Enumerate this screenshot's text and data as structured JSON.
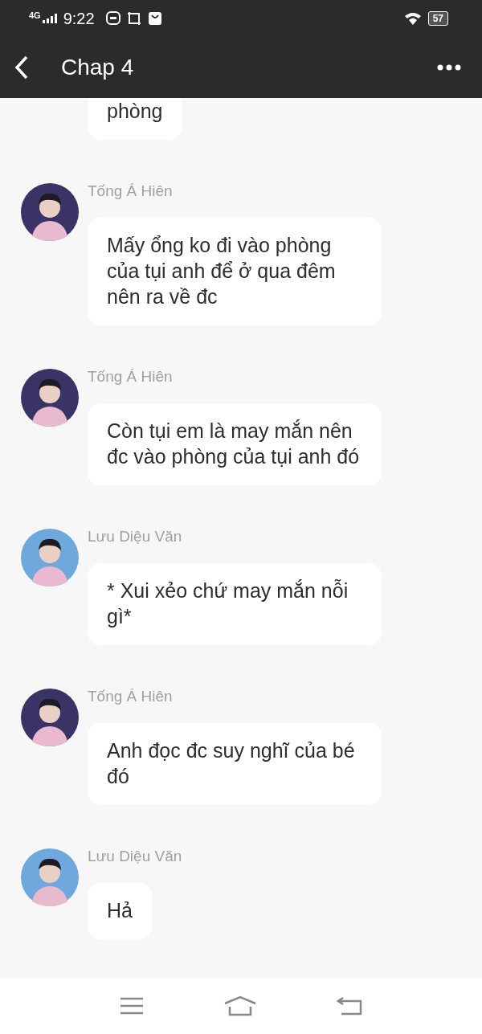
{
  "status_bar": {
    "network": "4G",
    "time": "9:22",
    "battery": "57"
  },
  "header": {
    "title": "Chap 4"
  },
  "messages": [
    {
      "text": "phòng"
    },
    {
      "sender": "Tống Á Hiên",
      "color": "#3a3466",
      "text": "Mấy ổng ko đi vào phòng của tụi anh để ở qua đêm nên ra về đc"
    },
    {
      "sender": "Tống Á Hiên",
      "color": "#3a3466",
      "text": "Còn tụi em là may mắn nên đc vào phòng của tụi anh đó"
    },
    {
      "sender": "Lưu Diệu Văn",
      "color": "#6fa8dc",
      "text": "* Xui xẻo chứ may mắn nỗi gì*"
    },
    {
      "sender": "Tống Á Hiên",
      "color": "#3a3466",
      "text": "Anh đọc đc suy nghĩ của bé đó"
    },
    {
      "sender": "Lưu Diệu Văn",
      "color": "#6fa8dc",
      "text": "Hả"
    }
  ]
}
